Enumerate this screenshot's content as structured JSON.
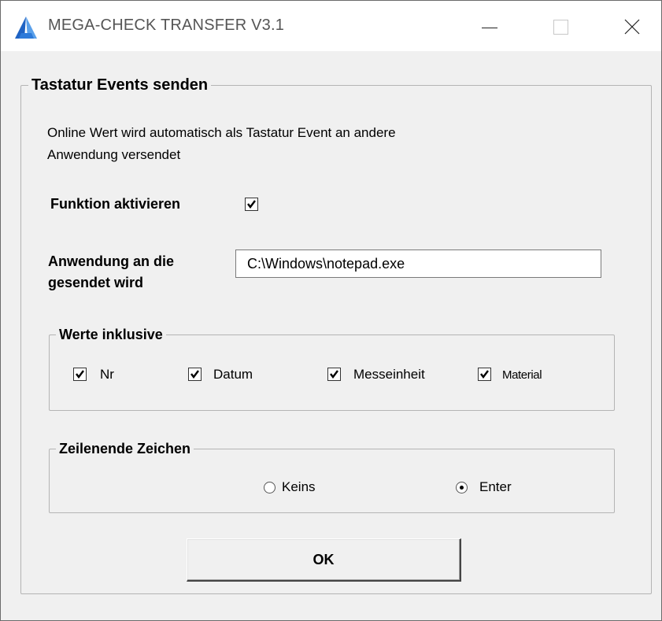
{
  "window": {
    "title": "MEGA-CHECK TRANSFER V3.1",
    "icon": "app-logo-triangle-icon",
    "accent_color": "#1e6fd9"
  },
  "main_group": {
    "legend": "Tastatur Events senden",
    "description_line1": "Online Wert wird automatisch als Tastatur Event an andere",
    "description_line2": "Anwendung versendet",
    "activate_label": "Funktion aktivieren",
    "activate_checked": true,
    "app_label_line1": "Anwendung an die",
    "app_label_line2": "gesendet wird",
    "app_path_value": "C:\\Windows\\notepad.exe"
  },
  "values_group": {
    "legend": "Werte inklusive",
    "options": [
      {
        "label": "Nr",
        "checked": true
      },
      {
        "label": "Datum",
        "checked": true
      },
      {
        "label": "Messeinheit",
        "checked": true
      },
      {
        "label": "Material",
        "checked": true
      }
    ]
  },
  "line_end_group": {
    "legend": "Zeilenende Zeichen",
    "options": [
      {
        "label": "Keins",
        "selected": false
      },
      {
        "label": "Enter",
        "selected": true
      }
    ]
  },
  "ok_label": "OK"
}
